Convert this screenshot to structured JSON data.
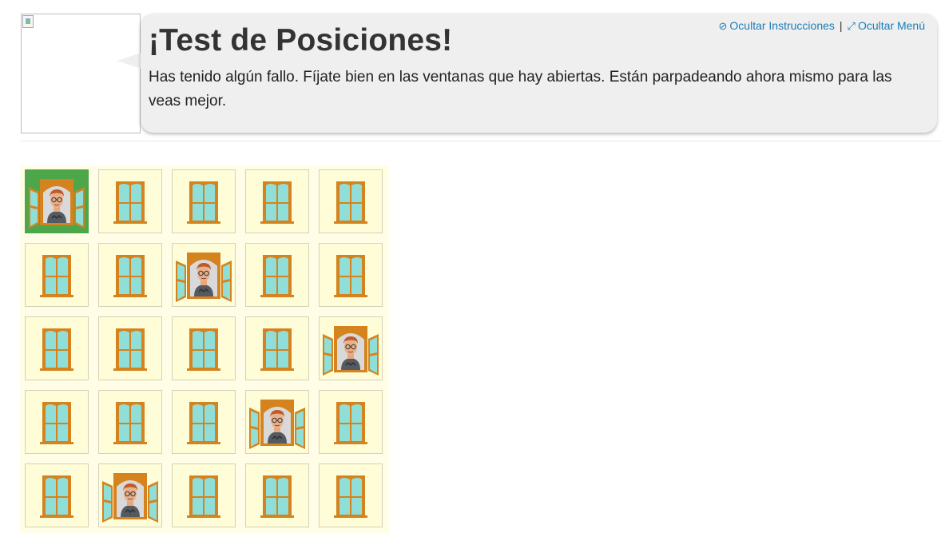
{
  "header": {
    "title": "¡Test de Posiciones!",
    "instructions": "Has tenido algún fallo. Fíjate bien en las ventanas que hay abiertas. Están parpadeando ahora mismo para las veas mejor.",
    "links": {
      "hide_instructions": "Ocultar Instrucciones",
      "separator": "|",
      "hide_menu": "Ocultar Menú"
    },
    "avatar_icon": "broken-image-icon"
  },
  "colors": {
    "window_frame": "#d4831e",
    "window_glass": "#8fded8",
    "correct_cell": "#4da64a",
    "cell_bg": "#fffcd8",
    "link": "#1a7db8"
  },
  "grid": {
    "rows": 5,
    "cols": 5,
    "cells": [
      [
        "open-correct",
        "closed",
        "closed",
        "closed",
        "closed"
      ],
      [
        "closed",
        "closed",
        "open",
        "closed",
        "closed"
      ],
      [
        "closed",
        "closed",
        "closed",
        "closed",
        "open"
      ],
      [
        "closed",
        "closed",
        "closed",
        "open",
        "closed"
      ],
      [
        "closed",
        "open",
        "closed",
        "closed",
        "closed"
      ]
    ]
  }
}
